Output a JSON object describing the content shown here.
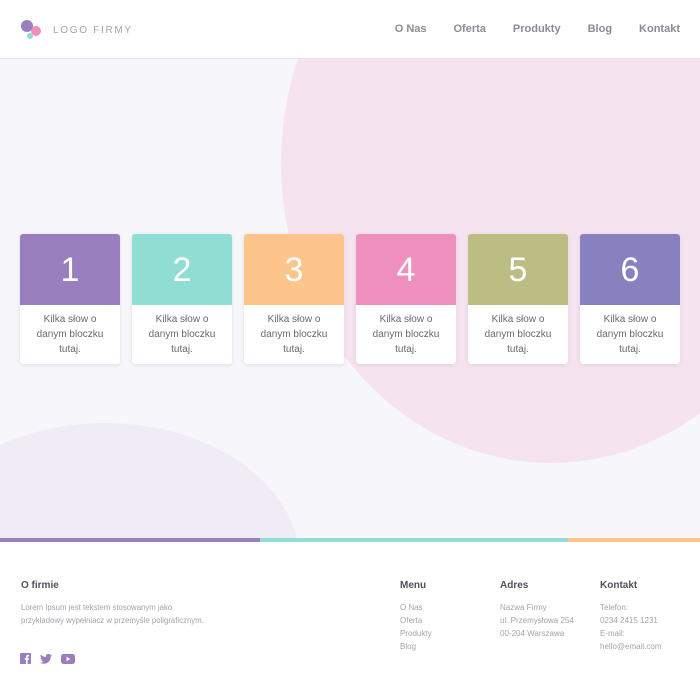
{
  "header": {
    "logo_text": "LOGO FIRMY",
    "nav": [
      "O Nas",
      "Oferta",
      "Produkty",
      "Blog",
      "Kontakt"
    ]
  },
  "cards": [
    {
      "number": "1",
      "text": "Kilka słow o danym bloczku tutaj.",
      "color": "#9a7fbe"
    },
    {
      "number": "2",
      "text": "Kilka słow o danym bloczku tutaj.",
      "color": "#90ddd4"
    },
    {
      "number": "3",
      "text": "Kilka słow o danym bloczku tutaj.",
      "color": "#fdc48c"
    },
    {
      "number": "4",
      "text": "Kilka słow o danym bloczku tutaj.",
      "color": "#ef8fbe"
    },
    {
      "number": "5",
      "text": "Kilka słow o danym bloczku tutaj.",
      "color": "#bbbd82"
    },
    {
      "number": "6",
      "text": "Kilka słow o danym bloczku tutaj.",
      "color": "#8781bf"
    }
  ],
  "stripe_colors": [
    "#9a7fbe",
    "#90ddd4",
    "#fdc48c"
  ],
  "colors": {
    "accent_purple": "#9a7fbe",
    "hero_background": "#f6f6fb",
    "circle_pink": "#f5e4ef",
    "circle_lavender": "#efecf6"
  },
  "footer": {
    "about": {
      "title": "O firmie",
      "text": "Lorem Ipsum jest tekstem stosowanym jako przykładowy wypełniacz w przemyśle poligraficznym."
    },
    "menu": {
      "title": "Menu",
      "items": [
        "O Nas",
        "Oferta",
        "Produkty",
        "Blog"
      ]
    },
    "address": {
      "title": "Adres",
      "lines": [
        "Nazwa Firmy",
        "ul. Przemysłowa 254",
        "00-204 Warszawa"
      ]
    },
    "contact": {
      "title": "Kontakt",
      "lines": [
        "Telefon:",
        "0234 2415 1231",
        "E-mail:",
        "hello@email.com"
      ]
    },
    "social_icons": [
      "facebook-icon",
      "twitter-icon",
      "youtube-icon"
    ]
  }
}
